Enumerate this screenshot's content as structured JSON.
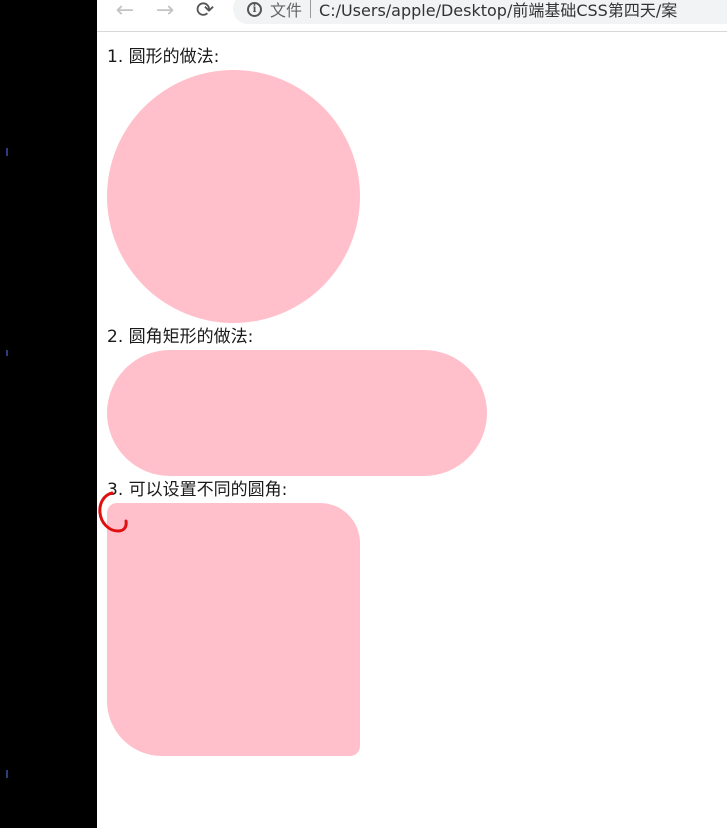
{
  "browser": {
    "back_icon": "←",
    "forward_icon": "→",
    "reload_icon": "⟳",
    "info_icon": "i",
    "scheme_label": "文件",
    "url": "C:/Users/apple/Desktop/前端基础CSS第四天/案"
  },
  "page": {
    "items": [
      {
        "label": "1. 圆形的做法:"
      },
      {
        "label": "2. 圆角矩形的做法:"
      },
      {
        "label": "3. 可以设置不同的圆角:"
      }
    ]
  },
  "colors": {
    "shape_fill": "#ffc0cb",
    "annotation": "#e01010"
  }
}
